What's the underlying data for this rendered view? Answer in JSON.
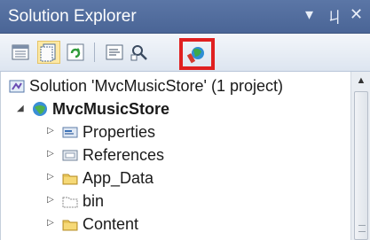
{
  "panel": {
    "title": "Solution Explorer",
    "dropdown_glyph": "▾",
    "pin_glyph": "ㄐ",
    "close_glyph": "✕"
  },
  "toolbar": {
    "buttons": [
      {
        "name": "properties-icon"
      },
      {
        "name": "show-all-files-icon",
        "active": true
      },
      {
        "name": "refresh-icon"
      },
      {
        "name": "view-code-icon"
      },
      {
        "name": "view-designer-icon"
      },
      {
        "name": "pin-icon",
        "highlighted": true
      }
    ]
  },
  "tree": {
    "items": [
      {
        "label": "Solution 'MvcMusicStore' (1 project)",
        "icon": "solution-icon",
        "level": 0
      },
      {
        "label": "MvcMusicStore",
        "icon": "project-icon",
        "level": 1,
        "expanded": true,
        "bold": true
      },
      {
        "label": "Properties",
        "icon": "properties-folder-icon",
        "level": 2,
        "expander": "▷"
      },
      {
        "label": "References",
        "icon": "references-icon",
        "level": 2,
        "expander": "▷"
      },
      {
        "label": "App_Data",
        "icon": "folder-icon",
        "level": 2,
        "expander": "▷"
      },
      {
        "label": "bin",
        "icon": "folder-outline-icon",
        "level": 2,
        "expander": "▷"
      },
      {
        "label": "Content",
        "icon": "folder-icon",
        "level": 2,
        "expander": "▷"
      }
    ]
  },
  "scrollbar": {
    "up_glyph": "▲"
  }
}
